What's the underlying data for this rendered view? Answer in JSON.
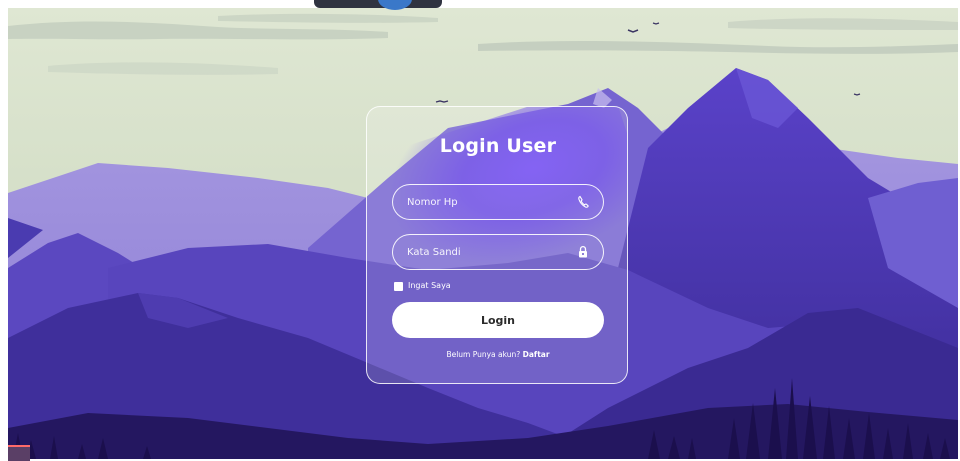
{
  "login": {
    "title": "Login User",
    "phone_placeholder": "Nomor Hp",
    "password_placeholder": "Kata Sandi",
    "remember_label": "Ingat Saya",
    "login_label": "Login",
    "register_prompt": "Belum Punya akun?",
    "register_link": "Daftar",
    "phone_icon": "phone-icon",
    "password_icon": "lock-icon"
  },
  "colors": {
    "sky": "#d7e2cc",
    "mountain_light": "#8f82d6",
    "mountain_mid": "#6250c6",
    "mountain_dark": "#3d2e95",
    "mountain_deepest": "#241760",
    "card_glow": "#7d5cf0",
    "button_bg": "#ffffff"
  }
}
